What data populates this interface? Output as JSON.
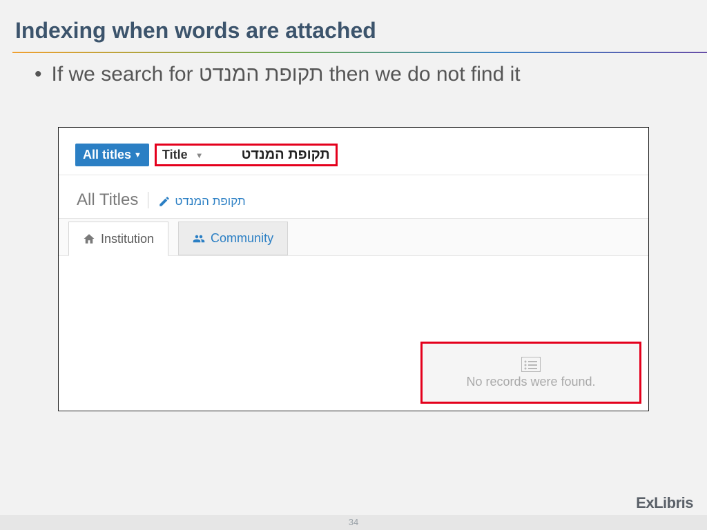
{
  "slide": {
    "title": "Indexing when words are attached",
    "bullet_pre": "If we search for  ",
    "bullet_hebrew": "תקופת המנדט",
    "bullet_post": " then we do not find it",
    "page_number": "34"
  },
  "search": {
    "scope_label": "All titles",
    "field_label": "Title",
    "query": "תקופת המנדט"
  },
  "results": {
    "heading": "All Titles",
    "term": "תקופת המנדט"
  },
  "tabs": {
    "institution": "Institution",
    "community": "Community"
  },
  "empty": {
    "message": "No records were found."
  },
  "brand": {
    "part1": "Ex",
    "part2": "Libris"
  }
}
